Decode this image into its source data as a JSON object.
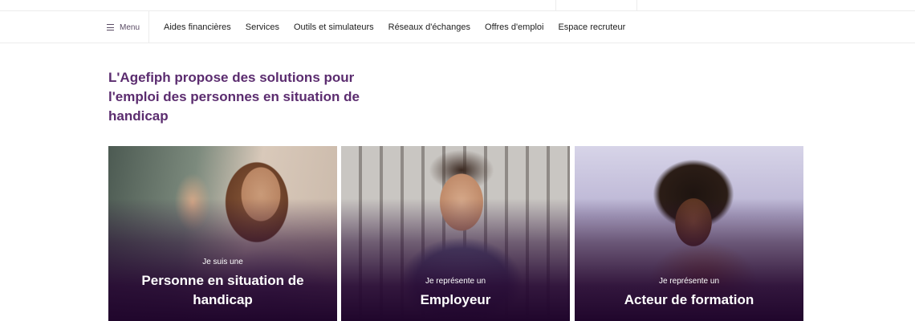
{
  "nav": {
    "menu_label": "Menu",
    "links": [
      "Aides financières",
      "Services",
      "Outils et simulateurs",
      "Réseaux d'échanges",
      "Offres d'emploi",
      "Espace recruteur"
    ]
  },
  "hero": {
    "title": "L'Agefiph propose des solutions pour l'emploi des personnes en situation de handicap"
  },
  "cards": [
    {
      "pre": "Je suis une",
      "main": "Personne en situation de handicap"
    },
    {
      "pre": "Je représente un",
      "main": "Employeur"
    },
    {
      "pre": "Je représente un",
      "main": "Acteur de formation"
    }
  ]
}
